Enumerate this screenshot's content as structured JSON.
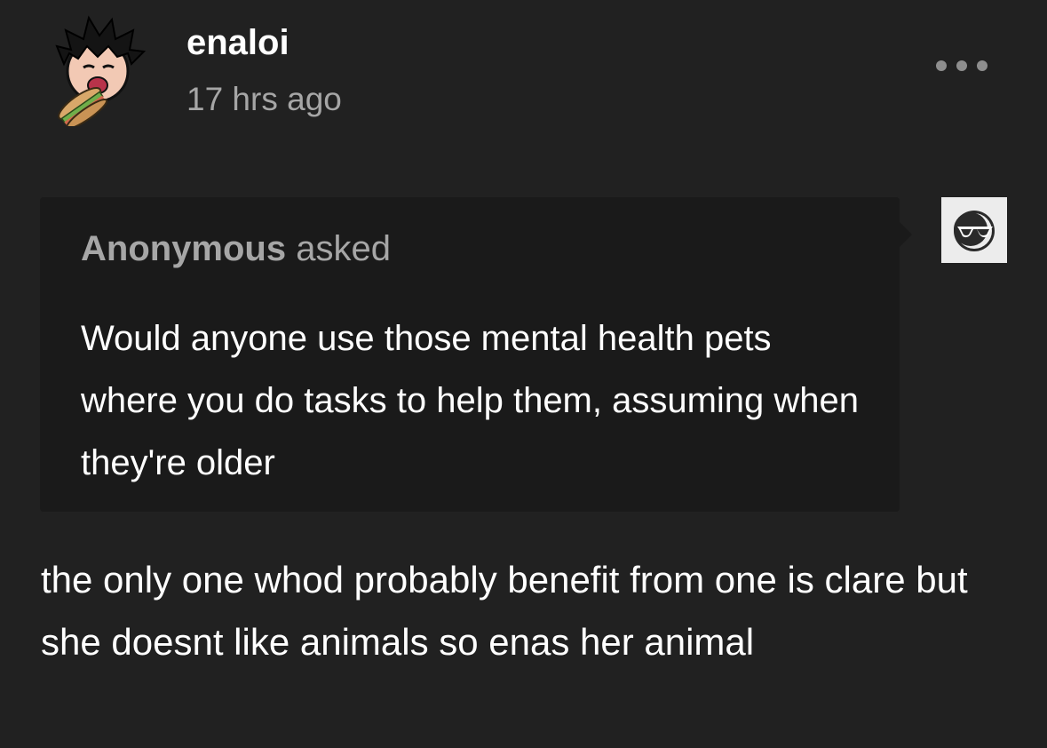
{
  "post": {
    "author": {
      "username": "enaloi",
      "avatar_icon": "chibi-avatar-eating-sandwich"
    },
    "timestamp": "17 hrs ago",
    "menu_icon": "ellipsis-icon"
  },
  "ask": {
    "asker": "Anonymous",
    "asked_label": "asked",
    "question": "Would anyone use those mental health pets where you do tasks to help them, assuming when they're older",
    "asker_avatar_icon": "anonymous-sunglasses-icon"
  },
  "answer": {
    "text": "the only one whod probably benefit from one is clare but she doesnt like animals so enas her animal"
  },
  "colors": {
    "background": "#212121",
    "ask_box": "#1a1a1a",
    "muted_text": "#a6a6a6",
    "text": "#ffffff"
  }
}
